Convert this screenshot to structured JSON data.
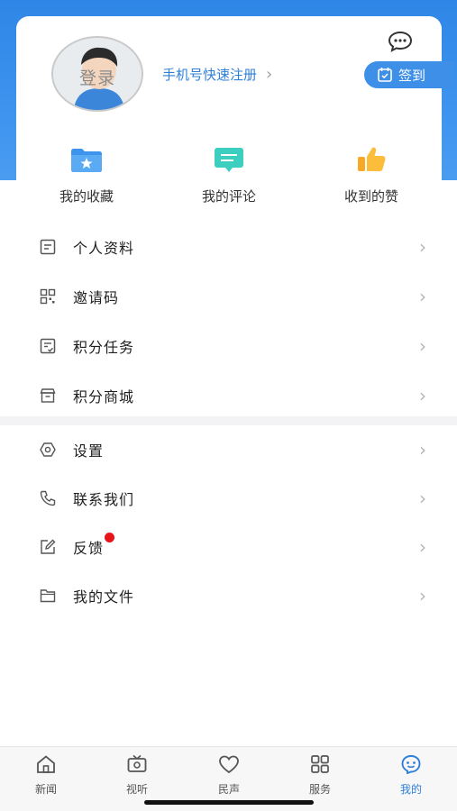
{
  "profile": {
    "avatar_label": "登录",
    "register_label": "手机号快速注册",
    "checkin_label": "签到"
  },
  "quick_actions": [
    {
      "label": "我的收藏",
      "icon": "folder-star-icon"
    },
    {
      "label": "我的评论",
      "icon": "comment-icon"
    },
    {
      "label": "收到的赞",
      "icon": "thumbs-up-icon"
    }
  ],
  "menu_group_1": [
    {
      "label": "个人资料",
      "icon": "profile-doc-icon"
    },
    {
      "label": "邀请码",
      "icon": "qr-code-icon"
    },
    {
      "label": "积分任务",
      "icon": "task-icon"
    },
    {
      "label": "积分商城",
      "icon": "store-icon"
    }
  ],
  "menu_group_2": [
    {
      "label": "设置",
      "icon": "settings-icon"
    },
    {
      "label": "联系我们",
      "icon": "phone-icon"
    },
    {
      "label": "反馈",
      "icon": "edit-icon",
      "badge": true
    },
    {
      "label": "我的文件",
      "icon": "folder-icon"
    }
  ],
  "tabbar": [
    {
      "label": "新闻",
      "icon": "home-icon"
    },
    {
      "label": "视听",
      "icon": "tv-icon"
    },
    {
      "label": "民声",
      "icon": "heart-icon"
    },
    {
      "label": "服务",
      "icon": "grid-icon"
    },
    {
      "label": "我的",
      "icon": "smile-icon",
      "active": true
    }
  ],
  "colors": {
    "brand_blue": "#2f86e6",
    "link_blue": "#2f7fd8",
    "badge_red": "#e8141b"
  }
}
